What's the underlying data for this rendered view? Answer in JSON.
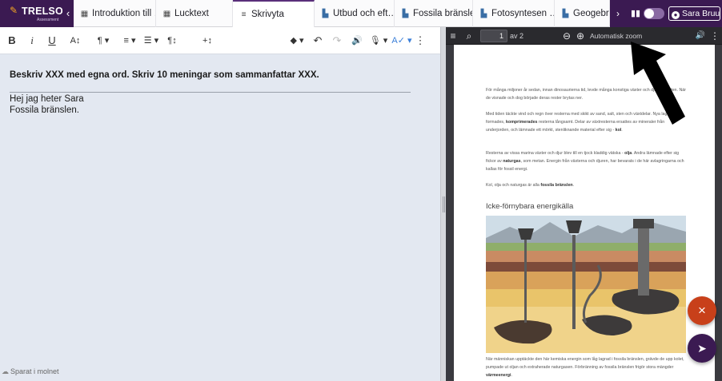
{
  "brand": {
    "name": "TRELSON",
    "sub": "Assessment"
  },
  "tabs": [
    {
      "label": "Introduktion till …",
      "icon": "grid-icon"
    },
    {
      "label": "Lucktext",
      "icon": "grid-icon"
    },
    {
      "label": "Skrivyta",
      "icon": "lines-icon",
      "active": true
    },
    {
      "label": "Utbud och eft…",
      "icon": "document-icon",
      "refresh": "C"
    },
    {
      "label": "Fossila bränslen",
      "icon": "document-icon",
      "refresh": "C"
    },
    {
      "label": "Fotosyntesen …",
      "icon": "document-icon",
      "refresh": "C"
    },
    {
      "label": "Geogebra",
      "icon": "document-icon"
    }
  ],
  "user": {
    "name": "Sara Bruun"
  },
  "editor": {
    "toolbar": {
      "bold": "B",
      "italic": "i",
      "underline": "U",
      "text_size": "A↕",
      "paragraph": "¶ ▾",
      "align": "≡ ▾",
      "list": "☰ ▾",
      "pilcrow": "¶↕",
      "insert": "+↕",
      "fill": "◆ ▾",
      "undo": "↶",
      "redo": "↷",
      "speak": "🔊",
      "mic": "🎙 ▾",
      "spellcheck": "A✓ ▾",
      "more": "⋮"
    },
    "prompt": "Beskriv XXX med egna ord. Skriv 10 meningar som sammanfattar XXX.",
    "lines": [
      "Hej jag heter Sara",
      "Fossila bränslen."
    ],
    "save_status": "Sparat i molnet"
  },
  "viewer": {
    "page_current": "1",
    "page_of": "av 2",
    "zoom": "Automatisk zoom",
    "paragraphs": [
      {
        "segments": [
          {
            "t": "För många miljoner år sedan, innan dinosaurierna tid, levde många konstiga växter och djur på jorden. När de visnade och dog började deras rester brytas ner.",
            "b": false
          }
        ]
      },
      {
        "segments": [
          {
            "t": "Med tiden täckte vind och regn över resterna med skikt av sand, salt, sten och växtdelar. Nya lager formades, ",
            "b": false
          },
          {
            "t": "komprimerades",
            "b": true
          },
          {
            "t": " resterna långsamt. Delar av växtresterna ersattes av mineraler från underjorden, och lämnade ett mörkt, stenliknande material efter sig - ",
            "b": false
          },
          {
            "t": "kol",
            "b": true
          },
          {
            "t": ".",
            "b": false
          }
        ]
      },
      {
        "segments": [
          {
            "t": "Resterna av vissa marina växter och djur blev till en tjock kladdig vätska - ",
            "b": false
          },
          {
            "t": "olja",
            "b": true
          },
          {
            "t": ". Andra lämnade efter sig fickor av ",
            "b": false
          },
          {
            "t": "naturgas",
            "b": true
          },
          {
            "t": ", som metan. Energin från växterna och djuren, har bevarats i de här avlagringarna och kallas för fossil energi.",
            "b": false
          }
        ]
      },
      {
        "segments": [
          {
            "t": "Kol, olja och naturgas är alla ",
            "b": false
          },
          {
            "t": "fossila bränslen",
            "b": true
          },
          {
            "t": ".",
            "b": false
          }
        ]
      }
    ],
    "heading": "Icke-förnybara energikälla",
    "caption_segments": [
      {
        "t": "När människan upptäckte den här kemiska energin som låg lagrad i fossila bränslen, grävde de upp kolet, pumpade ut oljan och extraherade naturgasen. Förbränning av fossila bränslen frigör stora mängder ",
        "b": false
      },
      {
        "t": "värmeenergi",
        "b": true
      },
      {
        "t": ".",
        "b": false
      }
    ]
  },
  "fab": {
    "close": "×",
    "send": "➤"
  },
  "colors": {
    "brand": "#3b1a52",
    "accent": "#c8401a",
    "editor_bg": "#e3e8f1",
    "viewer_bg": "#3a3a3f"
  }
}
